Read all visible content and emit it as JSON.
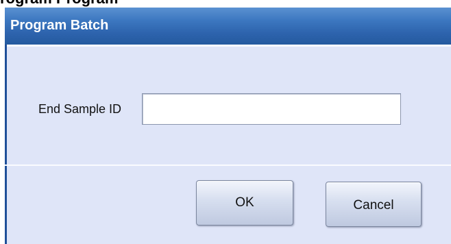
{
  "background_window": {
    "title_fragment": "rogram Program"
  },
  "dialog": {
    "title": "Program Batch",
    "field": {
      "label": "End Sample ID",
      "value": "",
      "placeholder": ""
    },
    "buttons": {
      "ok_label": "OK",
      "cancel_label": "Cancel"
    }
  },
  "colors": {
    "title_bar": "#3c77c0",
    "dialog_background": "#dfe5f8",
    "title_text": "#ffffff"
  }
}
